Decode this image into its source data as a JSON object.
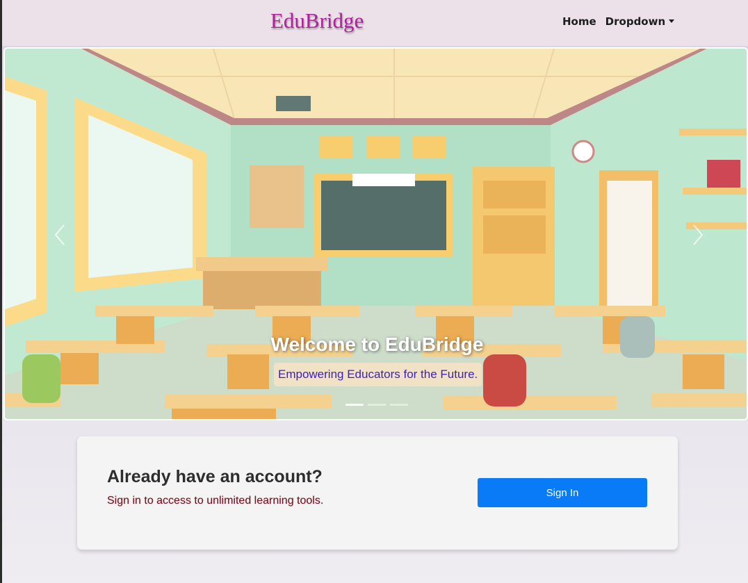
{
  "navbar": {
    "brand": "EduBridge",
    "links": [
      {
        "label": "Home"
      },
      {
        "label": "Dropdown"
      }
    ]
  },
  "carousel": {
    "caption_title": "Welcome to EduBridge",
    "caption_subtitle": "Empowering Educators for the Future.",
    "slide_count": 3,
    "active_slide": 1
  },
  "account_card": {
    "title": "Already have an account?",
    "text": "Sign in to access to unlimited learning tools.",
    "button_label": "Sign In"
  },
  "colors": {
    "brand": "#b1209e",
    "navbar_bg": "#ede1e9",
    "button_primary": "#0a7bf6",
    "caption_sub_text": "#3b1fc4"
  }
}
